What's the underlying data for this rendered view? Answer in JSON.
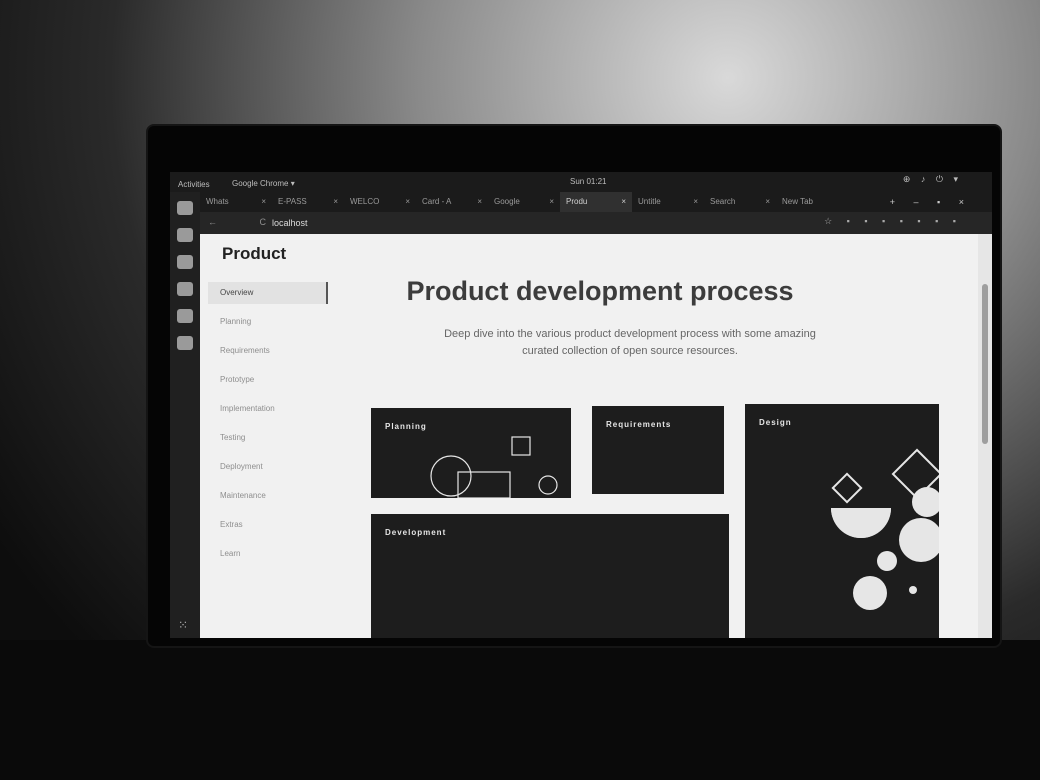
{
  "topbar": {
    "activities": "Activities",
    "app": "Google Chrome ▾",
    "clock": "Sun 01:21",
    "sys_icons": "⊕ ♪ ⏻ ▾"
  },
  "tabs": [
    {
      "label": "Whats"
    },
    {
      "label": "E-PASS"
    },
    {
      "label": "WELCO"
    },
    {
      "label": "Card - A"
    },
    {
      "label": "Google"
    },
    {
      "label": "Produ"
    },
    {
      "label": "Untitle"
    },
    {
      "label": "Search"
    },
    {
      "label": "New Tab"
    }
  ],
  "tab_close": "×",
  "address": {
    "nav": "← C",
    "url": "localhost",
    "ext_icons": "☆ ▪ ▪ ▪ ▪ ▪ ▪ ▪"
  },
  "window_controls": "+ – ▪ ×",
  "page": {
    "brand": "Product",
    "sidebar": [
      "Overview",
      "Planning",
      "Requirements",
      "Prototype",
      "Implementation",
      "Testing",
      "Deployment",
      "Maintenance",
      "Extras",
      "Learn"
    ],
    "headline": "Product development process",
    "subtitle": "Deep dive into the various product development process with some amazing curated collection of open source resources.",
    "cards": {
      "planning": "Planning",
      "requirements": "Requirements",
      "design": "Design",
      "development": "Development"
    }
  },
  "dock": {
    "apps_grid": "⁙"
  }
}
